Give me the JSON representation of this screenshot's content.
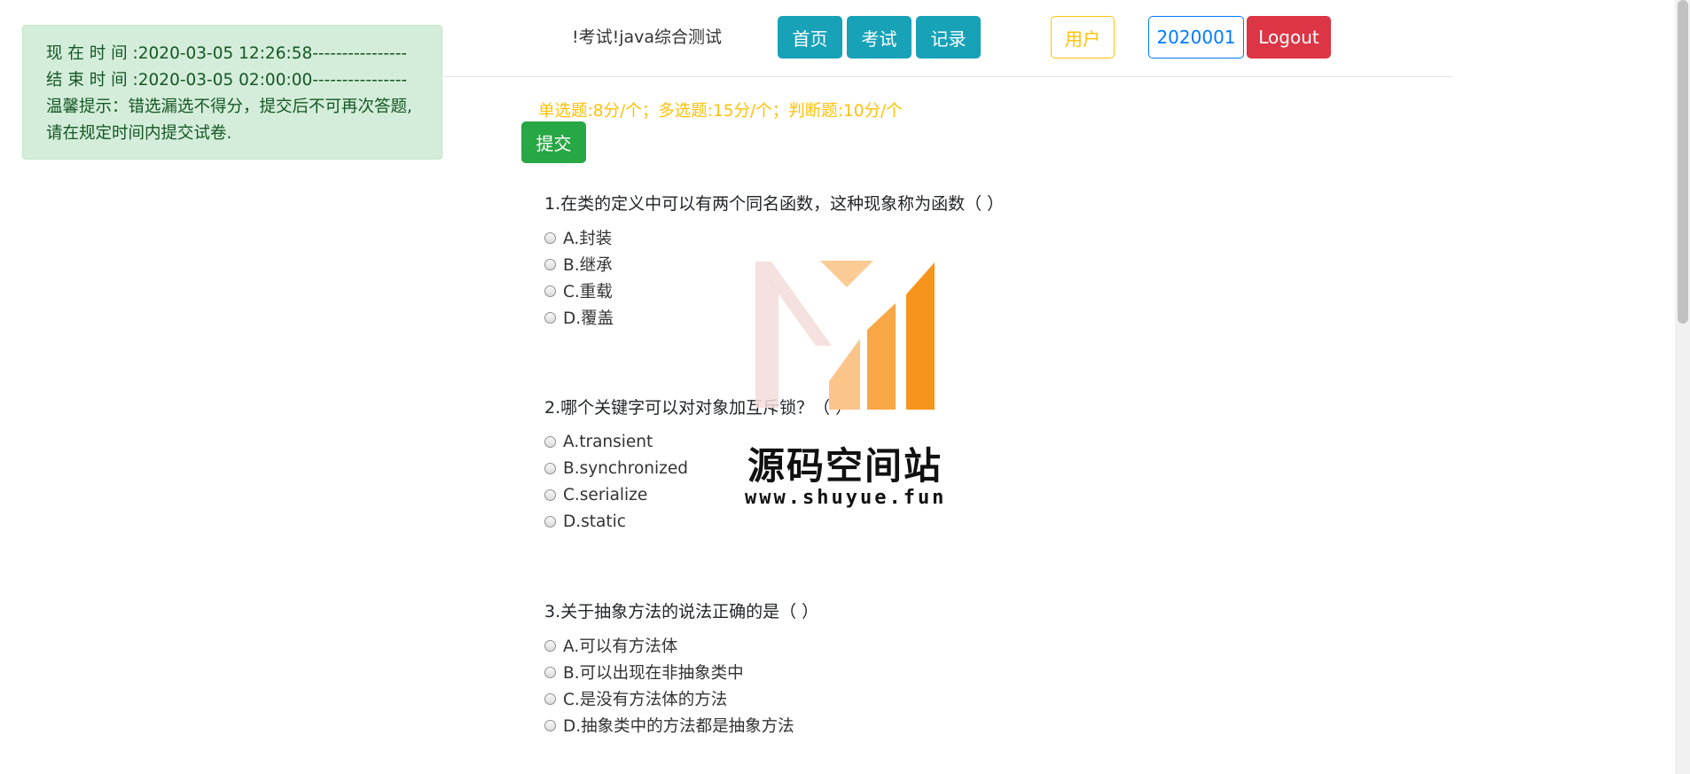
{
  "header": {
    "exam_title": "!考试!java综合测试",
    "nav": {
      "home": "首页",
      "exam": "考试",
      "record": "记录"
    },
    "user_label": "用户",
    "user_id": "2020001",
    "logout": "Logout"
  },
  "alert": {
    "current_time": "现 在 时 间 :2020-03-05 12:26:58----------------",
    "end_time": "结 束 时 间 :2020-03-05 02:00:00----------------",
    "tip": "温馨提示：错选漏选不得分，提交后不可再次答题,请在规定时间内提交试卷."
  },
  "score_info": "单选题:8分/个；多选题:15分/个；判断题:10分/个",
  "submit_label": "提交",
  "questions": [
    {
      "text": "1.在类的定义中可以有两个同名函数，这种现象称为函数（ ）",
      "options": [
        "A.封装",
        "B.继承",
        "C.重载",
        "D.覆盖"
      ]
    },
    {
      "text": "2.哪个关键字可以对对象加互斥锁？（ ）",
      "options": [
        "A.transient",
        "B.synchronized",
        "C.serialize",
        "D.static"
      ]
    },
    {
      "text": "3.关于抽象方法的说法正确的是（ ）",
      "options": [
        "A.可以有方法体",
        "B.可以出现在非抽象类中",
        "C.是没有方法体的方法",
        "D.抽象类中的方法都是抽象方法"
      ]
    }
  ],
  "watermark": {
    "title": "源码空间站",
    "url": "www.shuyue.fun",
    "colors": {
      "orange": "#f7941d",
      "light_orange": "#fbc58a",
      "pink": "#f3dcd9"
    }
  }
}
